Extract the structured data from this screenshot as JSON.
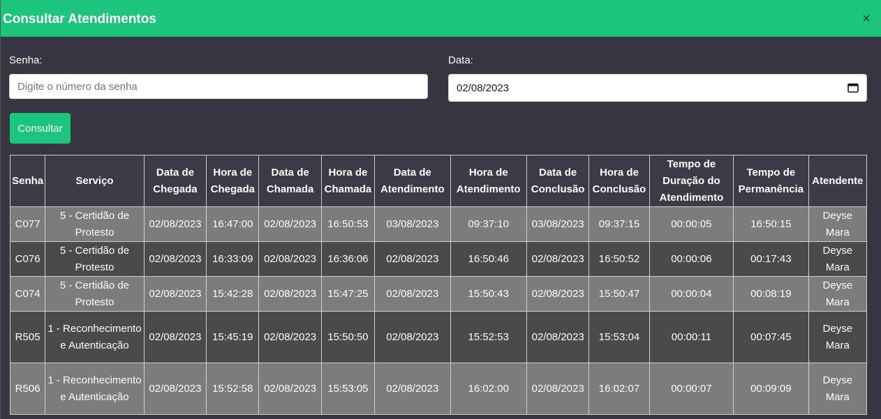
{
  "modal": {
    "title": "Consultar Atendimentos",
    "close_icon": "×"
  },
  "form": {
    "senha_label": "Senha:",
    "senha_placeholder": "Digite o número da senha",
    "data_label": "Data:",
    "data_value": "02/08/2023",
    "submit_label": "Consultar"
  },
  "colors": {
    "accent": "#1cc47e",
    "background": "#353640",
    "row_light": "#7c7c7c",
    "row_dark": "#4b4a4b"
  },
  "table": {
    "headers": [
      "Senha",
      "Serviço",
      "Data de Chegada",
      "Hora de Chegada",
      "Data de Chamada",
      "Hora de Chamada",
      "Data de Atendimento",
      "Hora de Atendimento",
      "Data de Conclusão",
      "Hora de Conclusão",
      "Tempo de Duração do Atendimento",
      "Tempo de Permanência",
      "Atendente"
    ],
    "rows": [
      [
        "C077",
        "5 - Certidão de Protesto",
        "02/08/2023",
        "16:47:00",
        "02/08/2023",
        "16:50:53",
        "03/08/2023",
        "09:37:10",
        "03/08/2023",
        "09:37:15",
        "00:00:05",
        "16:50:15",
        "Deyse Mara"
      ],
      [
        "C076",
        "5 - Certidão de Protesto",
        "02/08/2023",
        "16:33:09",
        "02/08/2023",
        "16:36:06",
        "02/08/2023",
        "16:50:46",
        "02/08/2023",
        "16:50:52",
        "00:00:06",
        "00:17:43",
        "Deyse Mara"
      ],
      [
        "C074",
        "5 - Certidão de Protesto",
        "02/08/2023",
        "15:42:28",
        "02/08/2023",
        "15:47:25",
        "02/08/2023",
        "15:50:43",
        "02/08/2023",
        "15:50:47",
        "00:00:04",
        "00:08:19",
        "Deyse Mara"
      ],
      [
        "R505",
        "1 - Reconhecimento e Autenticação",
        "02/08/2023",
        "15:45:19",
        "02/08/2023",
        "15:50:50",
        "02/08/2023",
        "15:52:53",
        "02/08/2023",
        "15:53:04",
        "00:00:11",
        "00:07:45",
        "Deyse Mara"
      ],
      [
        "R506",
        "1 - Reconhecimento e Autenticação",
        "02/08/2023",
        "15:52:58",
        "02/08/2023",
        "15:53:05",
        "02/08/2023",
        "16:02:00",
        "02/08/2023",
        "16:02:07",
        "00:00:07",
        "00:09:09",
        "Deyse Mara"
      ]
    ]
  }
}
